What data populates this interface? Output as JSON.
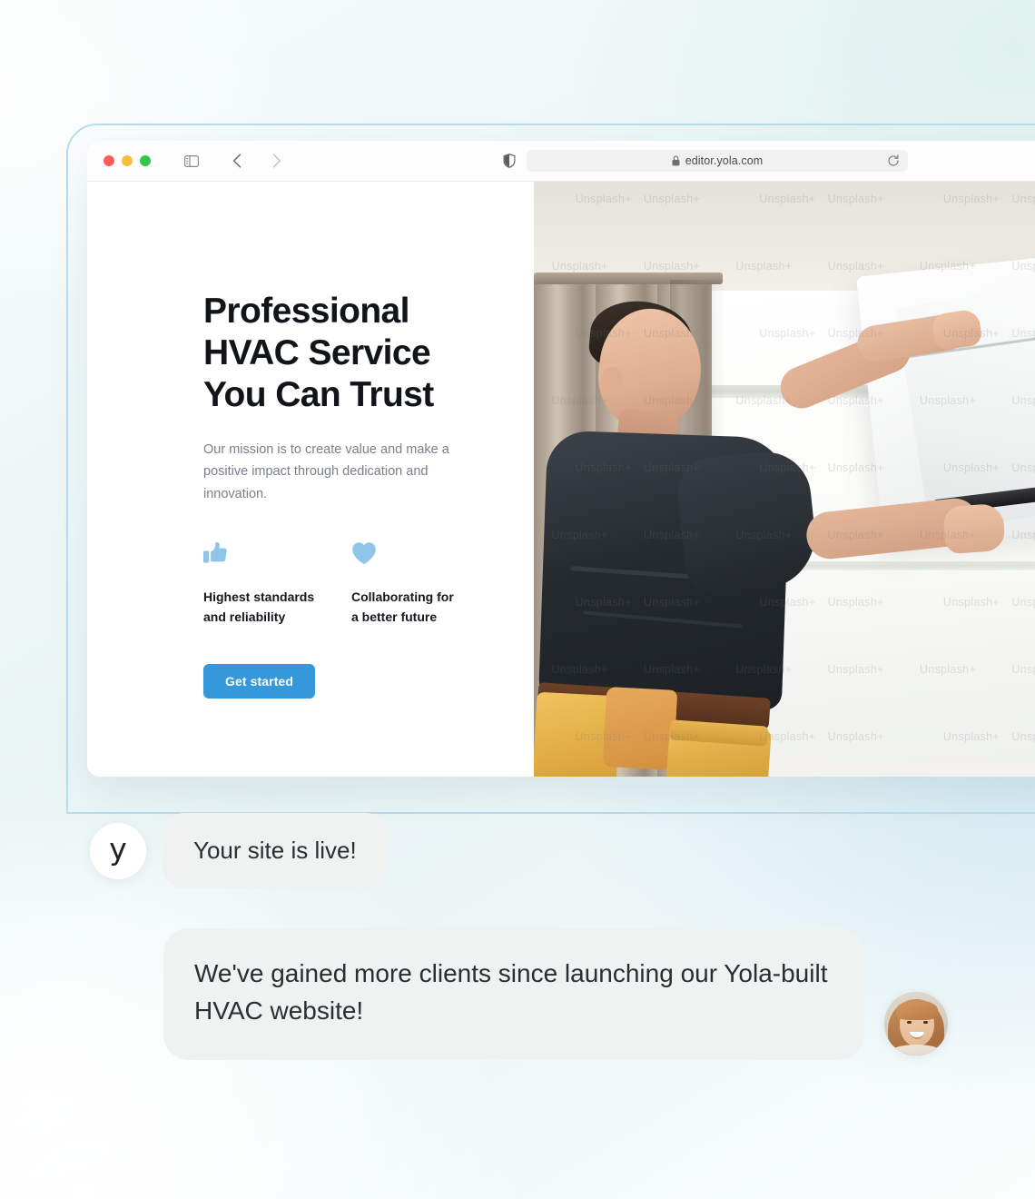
{
  "browser": {
    "traffic_lights": [
      "close",
      "minimize",
      "zoom"
    ],
    "sidebar_icon": "sidebar-toggle-icon",
    "back_icon": "chevron-left-icon",
    "forward_icon": "chevron-right-icon",
    "shield_icon": "shield-privacy-icon",
    "lock_icon": "lock-icon",
    "url": "editor.yola.com",
    "reload_icon": "reload-icon"
  },
  "site": {
    "hero": {
      "title_line1": "Professional",
      "title_line2": "HVAC Service",
      "title_line3": "You Can Trust",
      "subtitle": "Our mission is to create value and make a positive impact through dedication and innovation.",
      "cta_label": "Get started",
      "cta_color": "#3498db"
    },
    "features": [
      {
        "icon": "thumbs-up-icon",
        "label_line1": "Highest standards",
        "label_line2": "and reliability",
        "icon_color": "#8ec5e8"
      },
      {
        "icon": "heart-icon",
        "label_line1": "Collaborating for",
        "label_line2": "a better future",
        "icon_color": "#8ec5e8"
      }
    ],
    "photo": {
      "alt": "HVAC technician installing a wall-mounted air conditioner",
      "watermark": "Unsplash+"
    }
  },
  "chat": {
    "yola_avatar_letter": "y",
    "message_system": "Your site is live!",
    "message_testimonial": "We've gained more clients since launching our Yola-built HVAC website!",
    "user_avatar": "woman-smiling-avatar"
  },
  "theme": {
    "accent_blue": "#3498db",
    "icon_blue": "#8ec5e8",
    "frame_border": "#b9dced",
    "bubble_bg": "#f0f1f1"
  }
}
